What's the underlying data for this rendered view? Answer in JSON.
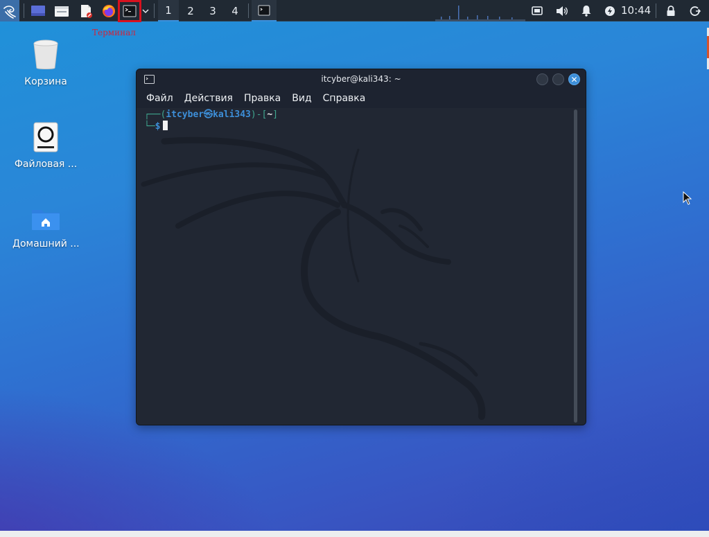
{
  "panel": {
    "workspaces": [
      "1",
      "2",
      "3",
      "4"
    ],
    "active_workspace": "1",
    "clock": "10:44",
    "icons": [
      "kali-menu-icon",
      "show-desktop-icon",
      "file-manager-icon",
      "text-editor-icon",
      "firefox-icon",
      "terminal-icon",
      "dropdown-chevron-icon",
      "terminal-task-icon",
      "display-icon",
      "volume-icon",
      "notification-bell-icon",
      "power-manager-icon",
      "lock-icon",
      "logout-icon"
    ]
  },
  "annotation": {
    "label": "Терминал",
    "color": "#d0243a"
  },
  "desktop": {
    "icons": [
      {
        "label": "Корзина",
        "icon": "trash-icon"
      },
      {
        "label": "Файловая ...",
        "icon": "filesystem-icon"
      },
      {
        "label": "Домашний ...",
        "icon": "home-folder-icon"
      }
    ]
  },
  "terminal": {
    "title": "itcyber@kali343: ~",
    "menu": [
      "Файл",
      "Действия",
      "Правка",
      "Вид",
      "Справка"
    ],
    "prompt": {
      "line1_open": "┌──(",
      "user_host": "itcyber㉿kali343",
      "line1_mid": ")-[",
      "cwd": "~",
      "line1_close": "]",
      "line2_prefix": "└─",
      "symbol": "$"
    }
  },
  "colors": {
    "accent": "#3d8fd9",
    "prompt_bracket": "#3fa78f",
    "prompt_user": "#3d8fd9"
  }
}
